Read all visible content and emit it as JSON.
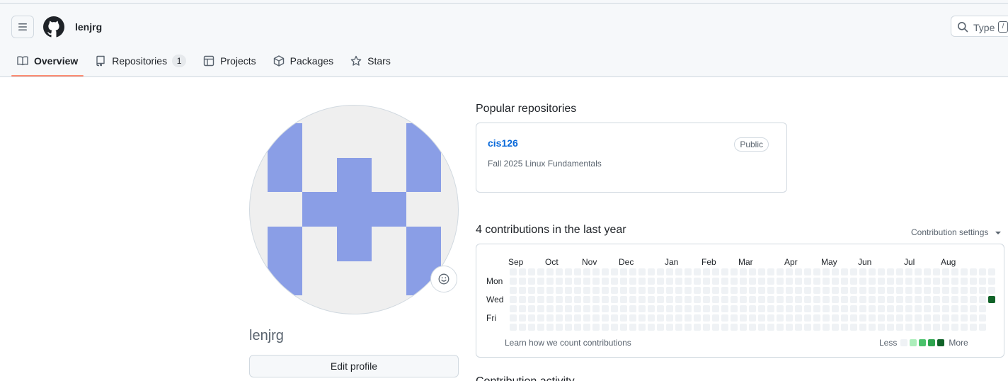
{
  "header": {
    "username": "lenjrg",
    "search": {
      "placeholder": "Type",
      "shortcut": "/"
    }
  },
  "tabs": [
    {
      "label": "Overview",
      "icon": "book-icon",
      "active": true
    },
    {
      "label": "Repositories",
      "icon": "repo-icon",
      "count": "1"
    },
    {
      "label": "Projects",
      "icon": "table-icon"
    },
    {
      "label": "Packages",
      "icon": "package-icon"
    },
    {
      "label": "Stars",
      "icon": "star-icon"
    }
  ],
  "profile": {
    "name": "lenjrg",
    "edit_label": "Edit profile",
    "avatar_color": "#8a9ee6"
  },
  "popular": {
    "title": "Popular repositories",
    "repos": [
      {
        "name": "cis126",
        "visibility": "Public",
        "description": "Fall 2025 Linux Fundamentals"
      }
    ]
  },
  "contributions": {
    "title": "4 contributions in the last year",
    "settings_label": "Contribution settings",
    "months": [
      "Sep",
      "Oct",
      "Nov",
      "Dec",
      "Jan",
      "Feb",
      "Mar",
      "Apr",
      "May",
      "Jun",
      "Jul",
      "Aug"
    ],
    "month_week_index": [
      0,
      4,
      8,
      12,
      17,
      21,
      25,
      30,
      34,
      38,
      43,
      47
    ],
    "day_labels": [
      "Mon",
      "Wed",
      "Fri"
    ],
    "weeks": 53,
    "last_week_days": 4,
    "active_cells": [
      {
        "week": 52,
        "day": 3,
        "level": 4
      }
    ],
    "learn_label": "Learn how we count contributions",
    "legend_less": "Less",
    "legend_more": "More",
    "level_colors": [
      "#eff2f5",
      "#aceebb",
      "#4ac26b",
      "#2da44e",
      "#116329"
    ]
  },
  "activity": {
    "title": "Contribution activity"
  }
}
